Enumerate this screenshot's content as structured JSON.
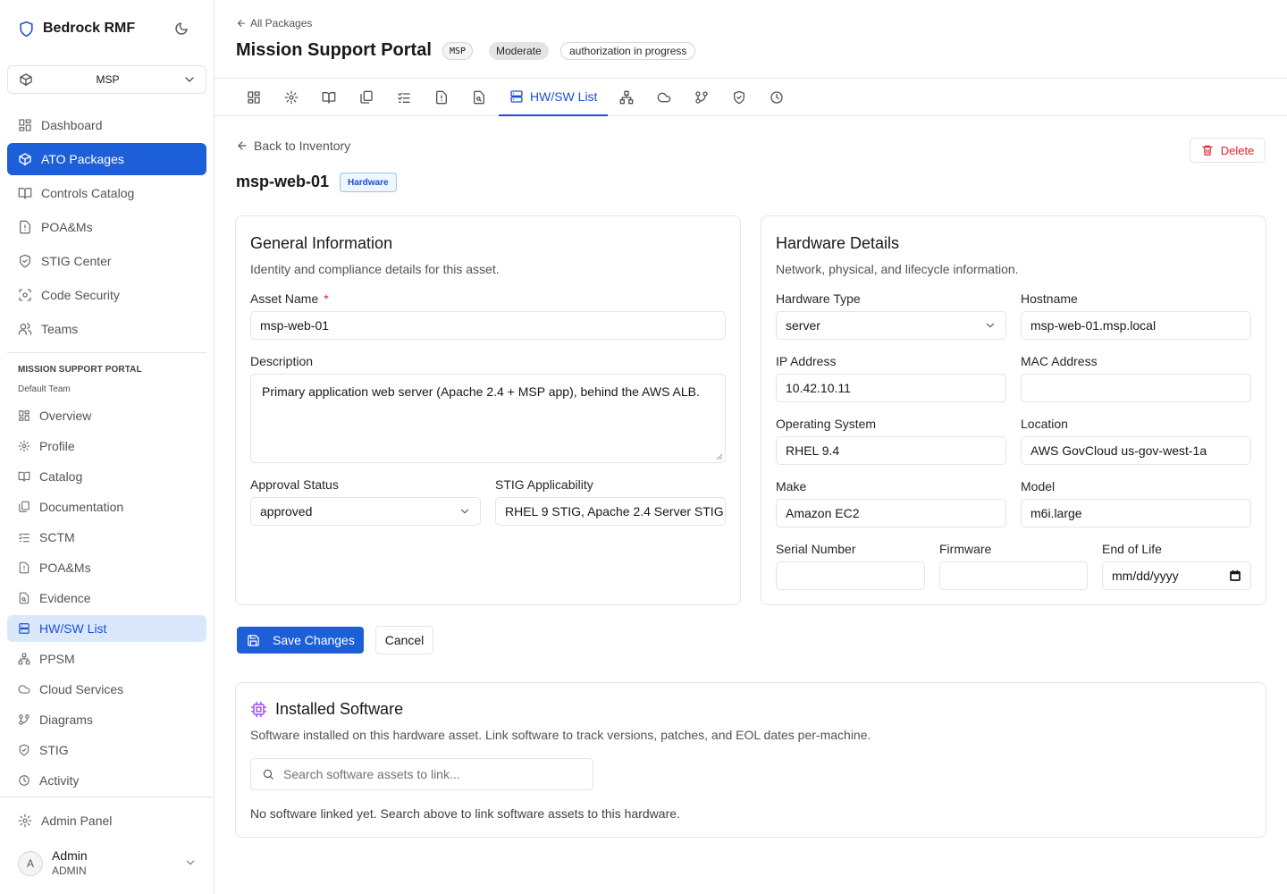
{
  "app": {
    "name": "Bedrock RMF"
  },
  "package_select": {
    "value": "MSP"
  },
  "nav": [
    {
      "label": "Dashboard",
      "icon": "dashboard-icon"
    },
    {
      "label": "ATO Packages",
      "icon": "package-icon"
    },
    {
      "label": "Controls Catalog",
      "icon": "book-icon"
    },
    {
      "label": "POA&Ms",
      "icon": "alert-icon"
    },
    {
      "label": "STIG Center",
      "icon": "shield-icon"
    },
    {
      "label": "Code Security",
      "icon": "scan-icon"
    },
    {
      "label": "Teams",
      "icon": "users-icon"
    }
  ],
  "package_section": {
    "title": "MISSION SUPPORT PORTAL",
    "team": "Default Team",
    "items": [
      {
        "label": "Overview"
      },
      {
        "label": "Profile"
      },
      {
        "label": "Catalog"
      },
      {
        "label": "Documentation"
      },
      {
        "label": "SCTM"
      },
      {
        "label": "POA&Ms"
      },
      {
        "label": "Evidence"
      },
      {
        "label": "HW/SW List"
      },
      {
        "label": "PPSM"
      },
      {
        "label": "Cloud Services"
      },
      {
        "label": "Diagrams"
      },
      {
        "label": "STIG"
      },
      {
        "label": "Activity"
      }
    ]
  },
  "admin_panel": {
    "label": "Admin Panel"
  },
  "user": {
    "initial": "A",
    "name": "Admin",
    "role": "ADMIN"
  },
  "header": {
    "back_label": "All Packages",
    "title": "Mission Support Portal",
    "code": "MSP",
    "impact": "Moderate",
    "status": "authorization in progress"
  },
  "tabs": {
    "active_label": "HW/SW List"
  },
  "asset": {
    "back_label": "Back to Inventory",
    "delete_label": "Delete",
    "name": "msp-web-01",
    "type_badge": "Hardware"
  },
  "general": {
    "title": "General Information",
    "description": "Identity and compliance details for this asset.",
    "asset_name_label": "Asset Name",
    "asset_name_required": "*",
    "asset_name_value": "msp-web-01",
    "description_label": "Description",
    "description_value": "Primary application web server (Apache 2.4 + MSP app), behind the AWS ALB.",
    "approval_label": "Approval Status",
    "approval_value": "approved",
    "stig_label": "STIG Applicability",
    "stig_value": "RHEL 9 STIG, Apache 2.4 Server STIG"
  },
  "hardware": {
    "title": "Hardware Details",
    "description": "Network, physical, and lifecycle information.",
    "type_label": "Hardware Type",
    "type_value": "server",
    "hostname_label": "Hostname",
    "hostname_value": "msp-web-01.msp.local",
    "ip_label": "IP Address",
    "ip_value": "10.42.10.11",
    "mac_label": "MAC Address",
    "mac_value": "",
    "os_label": "Operating System",
    "os_value": "RHEL 9.4",
    "location_label": "Location",
    "location_value": "AWS GovCloud us-gov-west-1a",
    "make_label": "Make",
    "make_value": "Amazon EC2",
    "model_label": "Model",
    "model_value": "m6i.large",
    "serial_label": "Serial Number",
    "serial_value": "",
    "firmware_label": "Firmware",
    "firmware_value": "",
    "eol_label": "End of Life",
    "eol_value": "mm/dd/yyyy"
  },
  "actions": {
    "save_label": "Save Changes",
    "cancel_label": "Cancel"
  },
  "software": {
    "title": "Installed Software",
    "description": "Software installed on this hardware asset. Link software to track versions, patches, and EOL dates per-machine.",
    "search_placeholder": "Search software assets to link...",
    "empty_text": "No software linked yet. Search above to link software assets to this hardware."
  }
}
